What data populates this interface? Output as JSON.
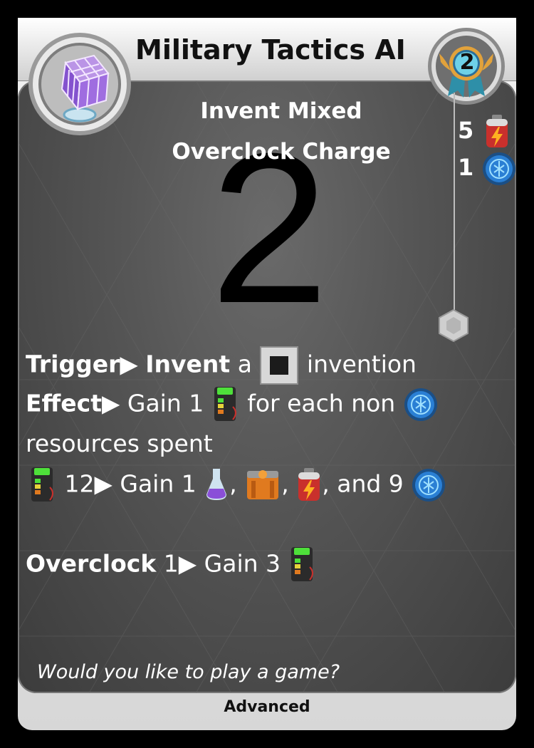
{
  "card": {
    "title": "Military Tactics AI",
    "level": "2",
    "subtitle_line1": "Invent Mixed",
    "subtitle_line2": "Overclock Charge",
    "big_number": "2",
    "cost": {
      "battery_count": "5",
      "data_count": "1",
      "battery_icon": "battery-icon",
      "data_icon": "data-token-icon"
    },
    "trigger": {
      "label": "Trigger",
      "action": "Invent",
      "a": "a",
      "invention": "invention"
    },
    "effect": {
      "label": "Effect",
      "gain": "Gain 1",
      "for_each": "for each non",
      "line2": "resources spent"
    },
    "bonus": {
      "threshold": "12",
      "gain": "Gain 1",
      "comma": ",",
      "and_nine": ", and 9"
    },
    "overclock": {
      "label": "Overclock",
      "level": "1",
      "gain": "Gain 3"
    },
    "flavor": "Would you like to play a game?",
    "footer": "Advanced",
    "colors": {
      "accent_orange": "#e07a1f",
      "token_blue": "#2a7fd4",
      "frame_gold": "#e2a23b",
      "energy_green": "#4ee03a"
    }
  }
}
